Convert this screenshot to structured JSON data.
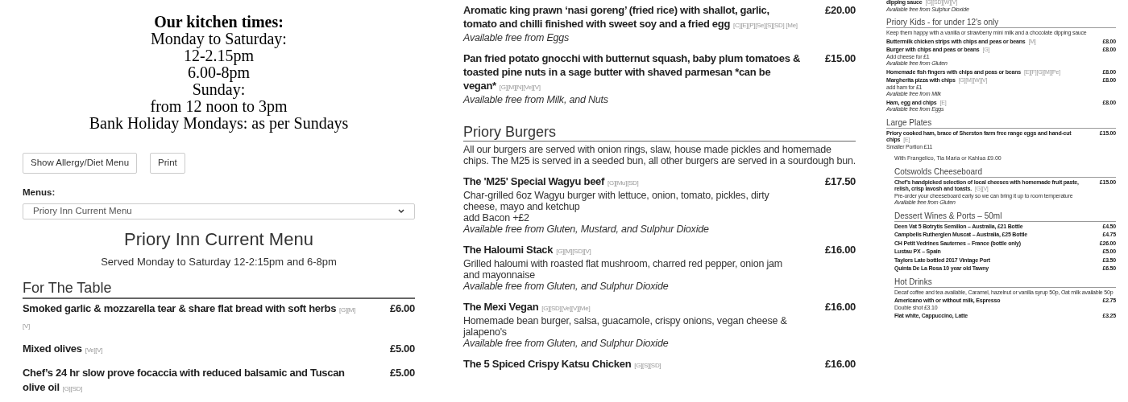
{
  "kitchen_times": {
    "title": "Our kitchen times:",
    "lines": [
      "Monday to Saturday:",
      "12-2.15pm",
      "6.00-8pm",
      "Sunday:",
      "from 12 noon to 3pm",
      "Bank Holiday Mondays: as per Sundays"
    ]
  },
  "buttons": [
    "Show Allergy/Diet Menu",
    "Print"
  ],
  "menus_label": "Menus:",
  "menu_select": {
    "value": "Priory Inn Current Menu"
  },
  "menu_title": "Priory Inn Current Menu",
  "menu_subtitle": "Served Monday to Saturday 12-2:15pm and 6-8pm",
  "left_sections": [
    {
      "title": "For The Table",
      "items": [
        {
          "name": "Smoked garlic & mozzarella tear & share flat bread with soft herbs",
          "tags": "[G][M][V]",
          "price": "£6.00"
        },
        {
          "name": "Mixed olives",
          "tags": "[Ve][V]",
          "price": "£5.00"
        },
        {
          "name": "Chef’s 24 hr slow prove focaccia with reduced balsamic and Tuscan olive oil",
          "tags": "[G][SD]",
          "price": "£5.00"
        }
      ]
    }
  ],
  "middle_sections": [
    {
      "items": [
        {
          "name": "Aromatic king prawn ‘nasi goreng’ (fried rice) with shallot, garlic, tomato and chilli finished with sweet soy and a fried egg",
          "tags": "[C][E][P][Se][S][SD] [Me]",
          "price": "£20.00",
          "free_from": "Available free from Eggs"
        },
        {
          "name": "Pan fried potato gnocchi with butternut squash, baby plum tomatoes & toasted pine nuts in a sage butter with shaved parmesan *can be vegan*",
          "tags": "[G][M][N][Ve][V]",
          "price": "£15.00",
          "free_from": "Available free from Milk, and Nuts"
        }
      ]
    },
    {
      "title": "Priory Burgers",
      "intro": "All our burgers are served with onion rings, slaw, house made pickles and homemade chips. The M25 is served in a seeded bun, all other burgers are served in a sourdough bun.",
      "items": [
        {
          "name": "The 'M25' Special Wagyu beef",
          "tags": "[G][Mu][SD]",
          "price": "£17.50",
          "lines": [
            "Char-grilled 6oz Wagyu burger with lettuce, onion, tomato, pickles, dirty cheese, mayo and ketchup",
            "add Bacon +£2"
          ],
          "free_from": "Available free from Gluten, Mustard, and Sulphur Dioxide"
        },
        {
          "name": "The Haloumi Stack",
          "tags": "[G][M][SD][V]",
          "price": "£16.00",
          "lines": [
            "Grilled haloumi with roasted flat mushroom, charred red pepper, onion jam and mayonnaise"
          ],
          "free_from": "Available free from Gluten, and Sulphur Dioxide"
        },
        {
          "name": "The Mexi Vegan",
          "tags": "[G][SD][Ve][V][Me]",
          "price": "£16.00",
          "lines": [
            "Homemade bean burger, salsa, guacamole, crispy onions, vegan cheese & jalapeno's"
          ],
          "free_from": "Available free from Gluten, and Sulphur Dioxide"
        },
        {
          "name": "The 5 Spiced Crispy Katsu Chicken",
          "tags": "[G][S][SD]",
          "price": "£16.00"
        }
      ]
    }
  ],
  "right_sections": [
    {
      "items": [
        {
          "name": "dipping sauce",
          "tags": "[G][SD][W][V]",
          "free_from": "Available free from Sulphur Dioxide"
        }
      ]
    },
    {
      "title": "Priory Kids - for under 12's only",
      "intro": "Keep them happy with a vanilla or strawberry mini milk and a chocolate dipping sauce",
      "items": [
        {
          "name": "Buttermilk chicken strips with chips and peas or beans",
          "tags": "[M]",
          "price": "£8.00"
        },
        {
          "name": "Burger with chips and peas or beans",
          "tags": "[G]",
          "price": "£8.00",
          "lines": [
            "Add cheese for £1"
          ],
          "free_from": "Available free from Gluten"
        },
        {
          "name": "Homemade fish fingers with chips and peas or beans",
          "tags": "[E][F][G][M][Pe]",
          "price": "£8.00"
        },
        {
          "name": "Margherita pizza with chips",
          "tags": "[G][M][W][V]",
          "price": "£8.00",
          "lines": [
            "add ham for £1"
          ],
          "free_from": "Available free from Milk"
        },
        {
          "name": "Ham, egg and chips",
          "tags": "[E]",
          "price": "£8.00",
          "free_from": "Available free from Eggs"
        }
      ]
    },
    {
      "title": "Large Plates",
      "items": [
        {
          "name": "Priory cooked ham, brace of Sherston farm free range eggs and hand-cut chips",
          "tags": "[E]",
          "price": "£15.00",
          "lines": [
            "Smaller Portion £11"
          ]
        }
      ]
    }
  ],
  "right_lower_note": "With Frangelico, Tia Maria or Kahlua £9.00",
  "right_lower_sections": [
    {
      "title": "Cotswolds Cheeseboard",
      "items": [
        {
          "name": "Chef’s handpicked selection of local cheeses with homemade fruit paste, relish, crisp lavosh and toasts.",
          "tags": "[G][V]",
          "price": "£15.00",
          "lines": [
            "Pre-order your cheeseboard early so we can bring it up to room temperature"
          ],
          "free_from": "Available free from Gluten"
        }
      ]
    },
    {
      "title": "Dessert Wines & Ports – 50ml",
      "items": [
        {
          "name": "Deen Vat 5 Botrytis Semillon – Australia, £21 Bottle",
          "price": "£4.50"
        },
        {
          "name": "Campbells Rutherglen Muscat – Australia, £25 Bottle",
          "price": "£4.75"
        },
        {
          "name": "CH Petit Vedrines Sauternes – France (bottle only)",
          "price": "£26.00"
        },
        {
          "name": "Lustau PX – Spain",
          "price": "£5.00"
        },
        {
          "name": "Taylors Late bottled 2017 Vintage Port",
          "price": "£3.50"
        },
        {
          "name": "Quinta De La Rosa 10 year old Tawny",
          "price": "£6.50"
        }
      ]
    },
    {
      "title": "Hot Drinks",
      "intro": "Decaf coffee and tea available, Caramel, hazelnut or vanilla syrup 50p, Oat milk available 50p",
      "items": [
        {
          "name": "Americano with or without milk, Espresso",
          "price": "£2.75",
          "lines": [
            "Double shot £3.10"
          ]
        },
        {
          "name": "Flat white, Cappuccino, Latte",
          "price": "£3.25"
        }
      ]
    }
  ]
}
